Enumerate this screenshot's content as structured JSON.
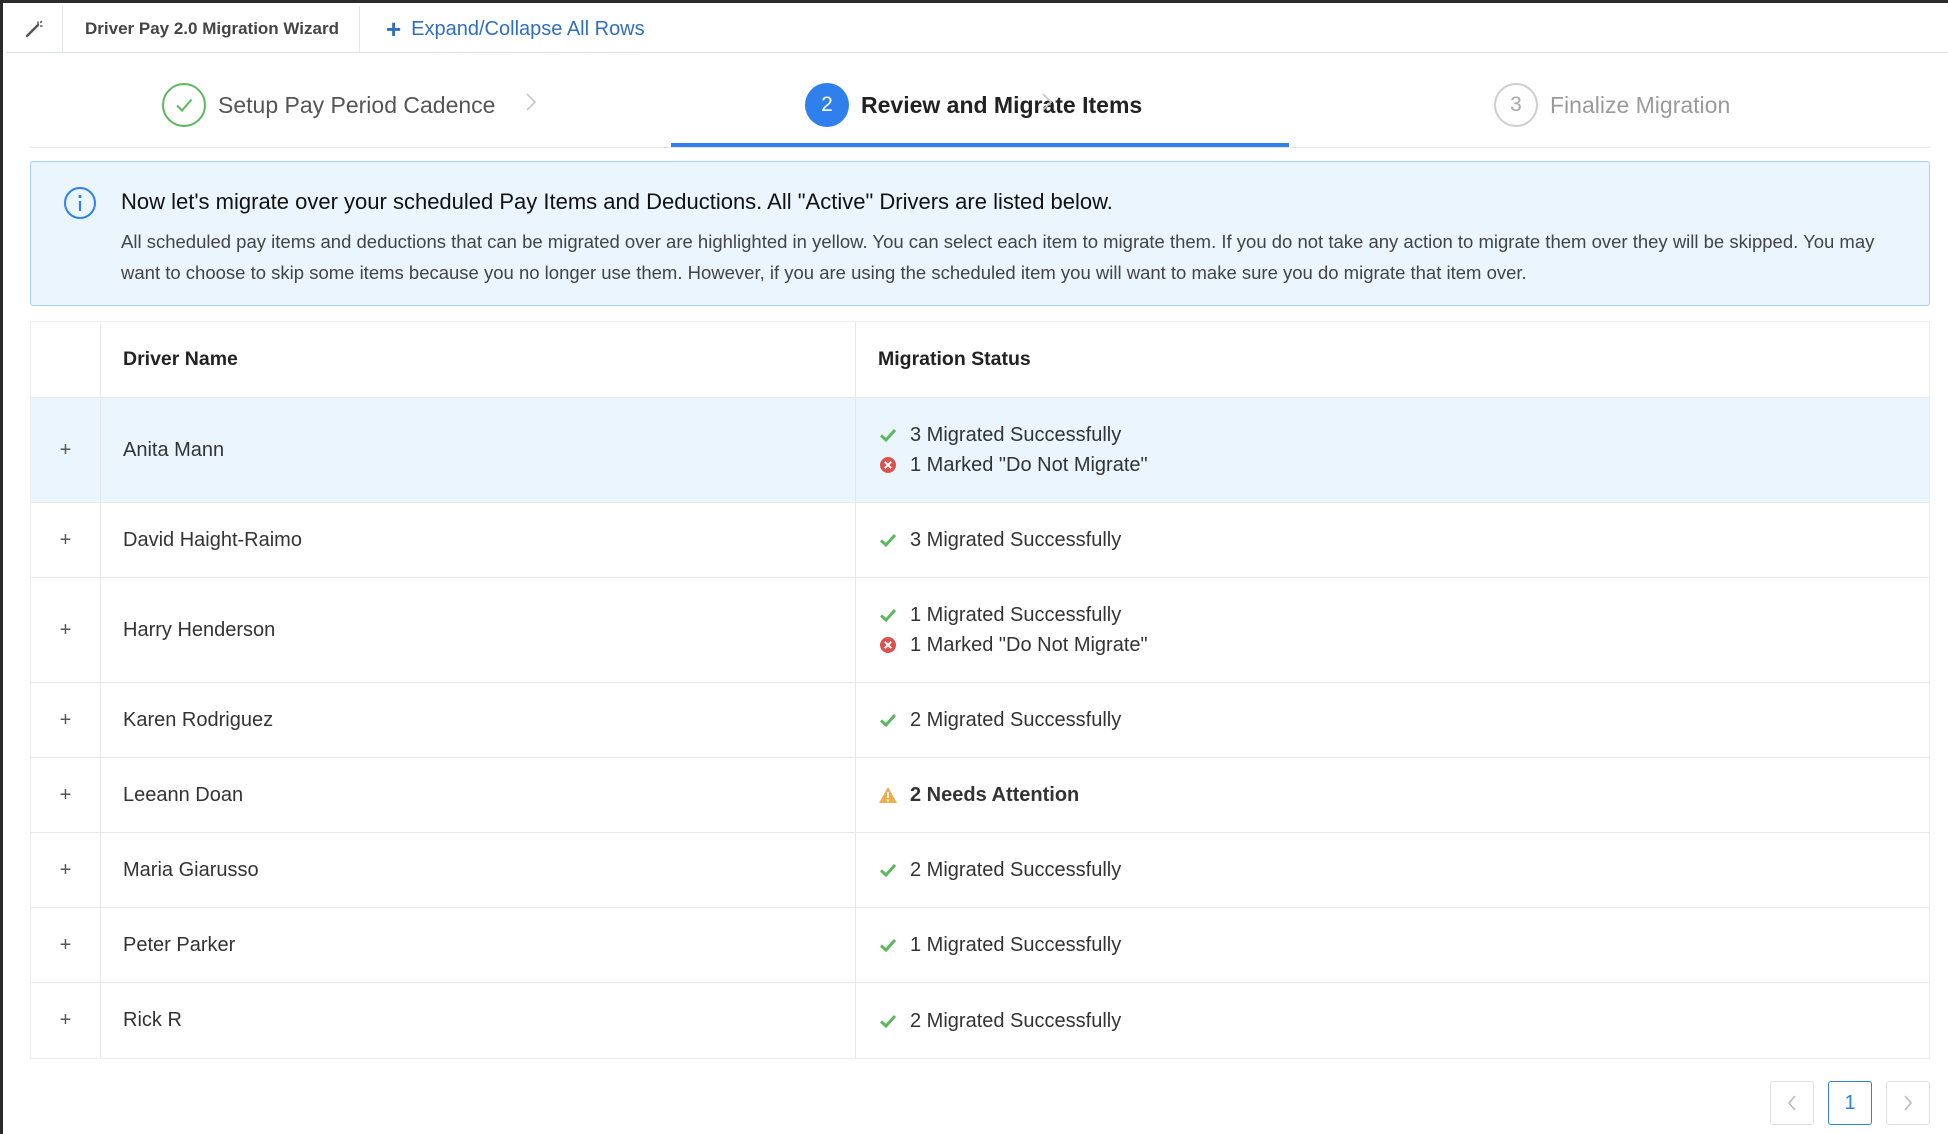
{
  "topbar": {
    "tool_icon": "wand-icon",
    "title": "Driver Pay 2.0 Migration Wizard",
    "expand_label": "Expand/Collapse All Rows"
  },
  "steps": [
    {
      "label": "Setup Pay Period Cadence",
      "state": "completed",
      "marker": "✓"
    },
    {
      "label": "Review and Migrate Items",
      "state": "active",
      "marker": "2"
    },
    {
      "label": "Finalize Migration",
      "state": "pending",
      "marker": "3"
    }
  ],
  "info": {
    "heading": "Now let's migrate over your scheduled Pay Items and Deductions. All \"Active\" Drivers are listed below.",
    "body": "All scheduled pay items and deductions that can be migrated over are highlighted in yellow. You can select each item to migrate them. If you do not take any action to migrate them over they will be skipped. You may want to choose to skip some items because you no longer use them. However, if you are using the scheduled item you will want to make sure you do migrate that item over."
  },
  "table": {
    "headers": {
      "name": "Driver Name",
      "status": "Migration Status"
    },
    "rows": [
      {
        "name": "Anita Mann",
        "status": [
          {
            "type": "success",
            "text": "3 Migrated Successfully"
          },
          {
            "type": "error",
            "text": "1 Marked \"Do Not Migrate\""
          }
        ]
      },
      {
        "name": "David Haight-Raimo",
        "status": [
          {
            "type": "success",
            "text": "3 Migrated Successfully"
          }
        ]
      },
      {
        "name": "Harry Henderson",
        "status": [
          {
            "type": "success",
            "text": "1 Migrated Successfully"
          },
          {
            "type": "error",
            "text": "1 Marked \"Do Not Migrate\""
          }
        ]
      },
      {
        "name": "Karen Rodriguez",
        "status": [
          {
            "type": "success",
            "text": "2 Migrated Successfully"
          }
        ]
      },
      {
        "name": "Leeann Doan",
        "status": [
          {
            "type": "warning",
            "text": "2 Needs Attention"
          }
        ]
      },
      {
        "name": "Maria Giarusso",
        "status": [
          {
            "type": "success",
            "text": "2 Migrated Successfully"
          }
        ]
      },
      {
        "name": "Peter Parker",
        "status": [
          {
            "type": "success",
            "text": "1 Migrated Successfully"
          }
        ]
      },
      {
        "name": "Rick R",
        "status": [
          {
            "type": "success",
            "text": "2 Migrated Successfully"
          }
        ]
      }
    ],
    "expand_symbol": "+"
  },
  "pagination": {
    "prev": "<",
    "current": "1",
    "next": ">"
  },
  "colors": {
    "accent": "#2f80ed",
    "success": "#5cb85c",
    "error": "#d9534f",
    "warning": "#f0ad4e",
    "info_bg": "#eaf5fd"
  }
}
